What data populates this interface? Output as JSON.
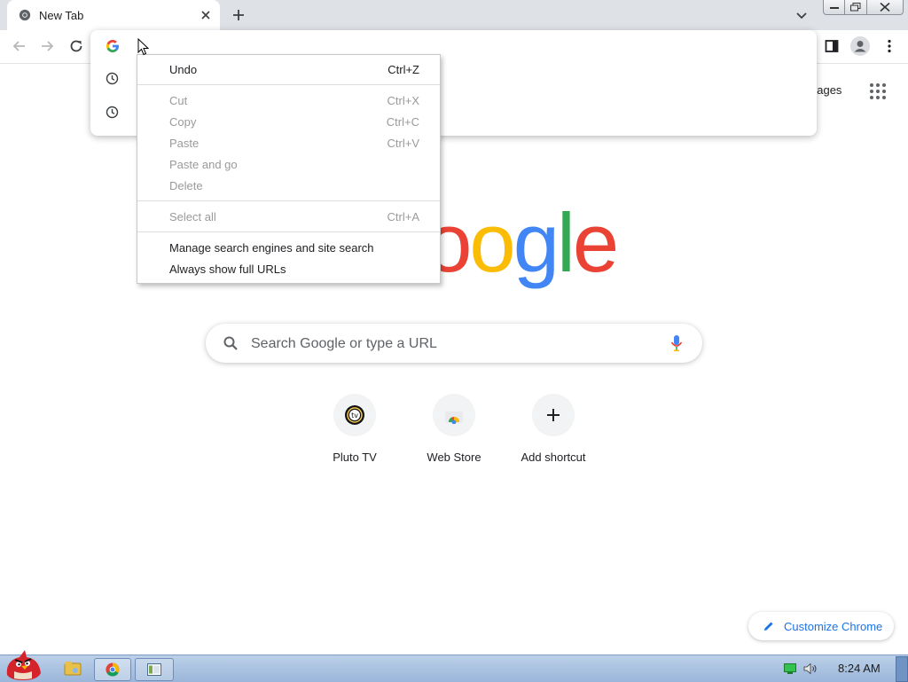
{
  "browser": {
    "tab": {
      "title": "New Tab"
    }
  },
  "context_menu": {
    "items": [
      {
        "label": "Undo",
        "shortcut": "Ctrl+Z",
        "enabled": true
      },
      {
        "label": "Cut",
        "shortcut": "Ctrl+X",
        "enabled": false
      },
      {
        "label": "Copy",
        "shortcut": "Ctrl+C",
        "enabled": false
      },
      {
        "label": "Paste",
        "shortcut": "Ctrl+V",
        "enabled": false
      },
      {
        "label": "Paste and go",
        "shortcut": "",
        "enabled": false
      },
      {
        "label": "Delete",
        "shortcut": "",
        "enabled": false
      },
      {
        "label": "Select all",
        "shortcut": "Ctrl+A",
        "enabled": false
      },
      {
        "label": "Manage search engines and site search",
        "shortcut": "",
        "enabled": true
      },
      {
        "label": "Always show full URLs",
        "shortcut": "",
        "enabled": true
      }
    ]
  },
  "ntp": {
    "images_link": "nages",
    "logo_text": "ogle",
    "search": {
      "placeholder": "Search Google or type a URL"
    },
    "shortcuts": [
      {
        "label": "Pluto TV",
        "icon": "pluto-tv-icon"
      },
      {
        "label": "Web Store",
        "icon": "web-store-icon"
      },
      {
        "label": "Add shortcut",
        "icon": "plus-icon"
      }
    ],
    "customize_label": "Customize Chrome"
  },
  "taskbar": {
    "clock": "8:24 AM"
  },
  "colors": {
    "google_blue": "#4285f4",
    "google_red": "#ea4335",
    "google_yellow": "#fbbc05",
    "google_green": "#34a853",
    "link_blue": "#1a73e8"
  }
}
